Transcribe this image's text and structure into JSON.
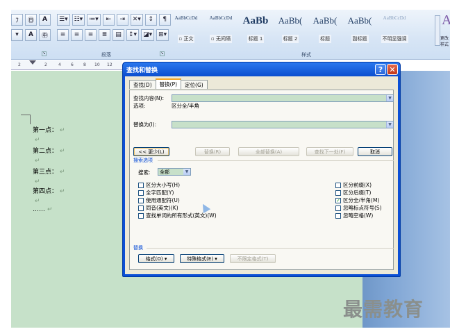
{
  "ribbon": {
    "font_group_label": "",
    "paragraph_group_label": "段落",
    "styles_group_label": "样式",
    "styles": [
      {
        "sample": "AaBbCcDd",
        "name": "▫ 正文"
      },
      {
        "sample": "AaBbCcDd",
        "name": "▫ 无间隔"
      },
      {
        "sample": "AaBb",
        "name": "标题 1"
      },
      {
        "sample": "AaBb(",
        "name": "标题 2"
      },
      {
        "sample": "AaBb(",
        "name": "标题"
      },
      {
        "sample": "AaBb(",
        "name": "副标题"
      },
      {
        "sample": "AaBbCcDd",
        "name": "不明显强调"
      }
    ],
    "change_styles": "更改样式",
    "big_a": "A"
  },
  "ruler": {
    "ticks": [
      "2",
      "2",
      "4",
      "6",
      "8",
      "10",
      "12"
    ]
  },
  "document": {
    "lines": [
      "第一点：",
      "第二点：",
      "第三点：",
      "第四点：",
      "……"
    ],
    "para_mark": "↵",
    "empty_mark": "↵"
  },
  "dialog": {
    "title": "查找和替换",
    "help": "?",
    "close": "✕",
    "tabs": [
      "查找(D)",
      "替换(P)",
      "定位(G)"
    ],
    "find_label": "查找内容(N):",
    "options_label": "选项:",
    "options_value": "区分全/半角",
    "replace_label": "替换为(I):",
    "buttons": {
      "less": "<< 更少(L)",
      "replace": "替换(R)",
      "replace_all": "全部替换(A)",
      "find_next": "查找下一处(F)",
      "cancel": "取消"
    },
    "search_options_title": "搜索选项",
    "search_label": "搜索:",
    "search_value": "全部",
    "left_options": [
      {
        "label": "区分大小写(H)",
        "checked": false
      },
      {
        "label": "全字匹配(Y)",
        "checked": false
      },
      {
        "label": "使用通配符(U)",
        "checked": false
      },
      {
        "label": "同音(英文)(K)",
        "checked": false
      },
      {
        "label": "查找单词的所有形式(英文)(W)",
        "checked": false
      }
    ],
    "right_options": [
      {
        "label": "区分前缀(X)",
        "checked": false
      },
      {
        "label": "区分后缀(T)",
        "checked": false
      },
      {
        "label": "区分全/半角(M)",
        "checked": true
      },
      {
        "label": "忽略标点符号(S)",
        "checked": false
      },
      {
        "label": "忽略空格(W)",
        "checked": false
      }
    ],
    "replace_section_title": "替换",
    "format_btn": "格式(O) ▾",
    "special_btn": "特殊格式(E) ▾",
    "no_format_btn": "不限定格式(T)"
  },
  "watermark": "最需教育"
}
